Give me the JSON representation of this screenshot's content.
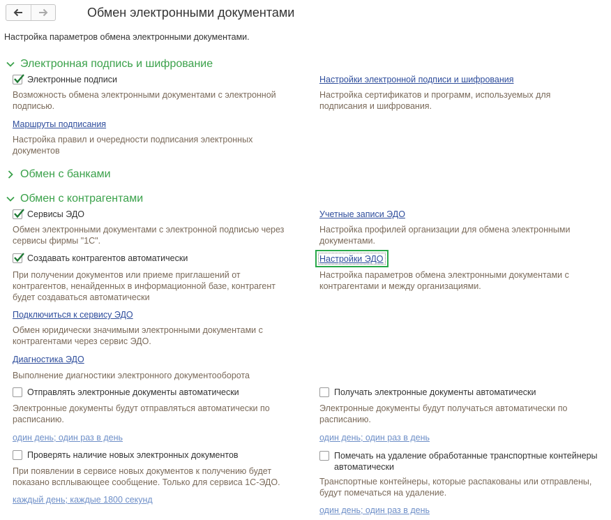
{
  "header": {
    "title": "Обмен электронными документами",
    "subtitle": "Настройка параметров обмена электронными документами."
  },
  "sections": {
    "signature": {
      "title": "Электронная подпись и шифрование",
      "expanded": true
    },
    "banks": {
      "title": "Обмен с банками",
      "expanded": false
    },
    "counterparties": {
      "title": "Обмен с контрагентами",
      "expanded": true
    }
  },
  "signature": {
    "e_signatures": {
      "label": "Электронные подписи",
      "checked": true,
      "desc": "Возможность обмена электронными документами с электронной подписью."
    },
    "settings_link": {
      "label": "Настройки электронной подписи и шифрования",
      "desc": "Настройка сертификатов и программ, используемых для подписания и шифрования."
    },
    "routes_link": {
      "label": "Маршруты подписания",
      "desc": "Настройка правил и очередности подписания электронных документов"
    }
  },
  "counterparties": {
    "edo_services": {
      "label": "Сервисы ЭДО",
      "checked": true,
      "desc": "Обмен электронными документами с электронной подписью через сервисы фирмы \"1С\"."
    },
    "accounts_link": {
      "label": "Учетные записи ЭДО",
      "desc": "Настройка профилей организации для обмена электронными документами."
    },
    "auto_create": {
      "label": "Создавать контрагентов автоматически",
      "checked": true,
      "desc": "При получении документов или приеме приглашений от контрагентов, ненайденных в информационной базе, контрагент будет создаваться автоматически"
    },
    "edo_settings_link": {
      "label": "Настройки ЭДО",
      "desc": "Настройка параметров обмена электронными документами с контрагентами и между организациями."
    },
    "connect_link": {
      "label": "Подключиться к сервису ЭДО",
      "desc": "Обмен юридически значимыми электронными документами с контрагентами через сервис ЭДО."
    },
    "diagnostics_link": {
      "label": "Диагностика ЭДО",
      "desc": "Выполнение диагностики электронного документооборота"
    },
    "auto_send": {
      "label": "Отправлять электронные документы автоматически",
      "checked": false,
      "desc": "Электронные документы будут отправляться автоматически по расписанию.",
      "schedule": "один день; один раз в день"
    },
    "auto_receive": {
      "label": "Получать электронные документы автоматически",
      "checked": false,
      "desc": "Электронные документы будут получаться автоматически по расписанию.",
      "schedule": "один день; один раз в день"
    },
    "check_new": {
      "label": "Проверять наличие новых электронных документов",
      "checked": false,
      "desc": "При появлении в сервисе новых документов к получению будет показано всплывающее сообщение. Только для сервиса 1С-ЭДО.",
      "schedule": "каждый день; каждые 1800 секунд"
    },
    "mark_delete": {
      "label": "Помечать на удаление обработанные транспортные контейнеры автоматически",
      "checked": false,
      "desc": "Транспортные контейнеры, которые распакованы или отправлены, будут помечаться на удаление.",
      "schedule": "один день; один раз в день"
    }
  },
  "colors": {
    "section_green": "#3aa14a",
    "link_blue": "#2e4d9c",
    "schedule_blue": "#6e8fc8",
    "desc_brown": "#7a6a5a",
    "focus_green": "#29a84a"
  },
  "icons": {
    "back": "arrow-left-icon",
    "forward": "arrow-right-icon",
    "expanded": "chevron-down-icon",
    "collapsed": "chevron-right-icon",
    "check": "check-icon"
  }
}
